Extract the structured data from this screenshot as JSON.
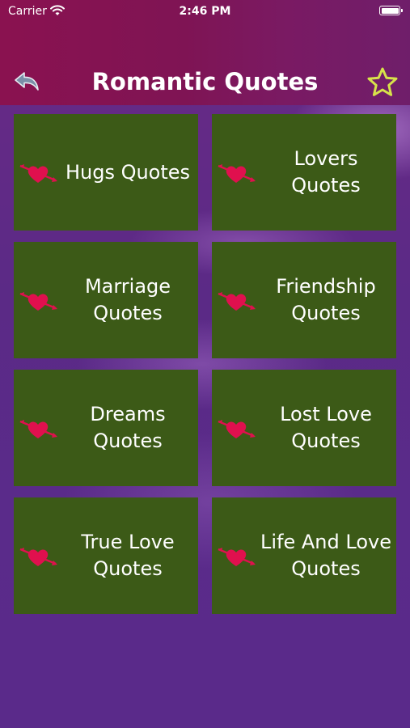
{
  "status_bar": {
    "carrier": "Carrier",
    "time": "2:46 PM"
  },
  "header": {
    "title": "Romantic Quotes"
  },
  "icons": {
    "back": "back-arrow-icon",
    "favorite": "star-icon",
    "tile": "heart-with-arrow-icon"
  },
  "colors": {
    "header": "#8a1250",
    "tile": "#3c5a17",
    "background": "#5a2a8a",
    "star": "#d7e24a",
    "heart": "#e0104e"
  },
  "tiles": [
    {
      "label": "Hugs Quotes"
    },
    {
      "label": "Lovers Quotes"
    },
    {
      "label": "Marriage Quotes"
    },
    {
      "label": "Friendship Quotes"
    },
    {
      "label": "Dreams Quotes"
    },
    {
      "label": "Lost Love Quotes"
    },
    {
      "label": "True Love Quotes"
    },
    {
      "label": "Life And Love Quotes"
    }
  ]
}
